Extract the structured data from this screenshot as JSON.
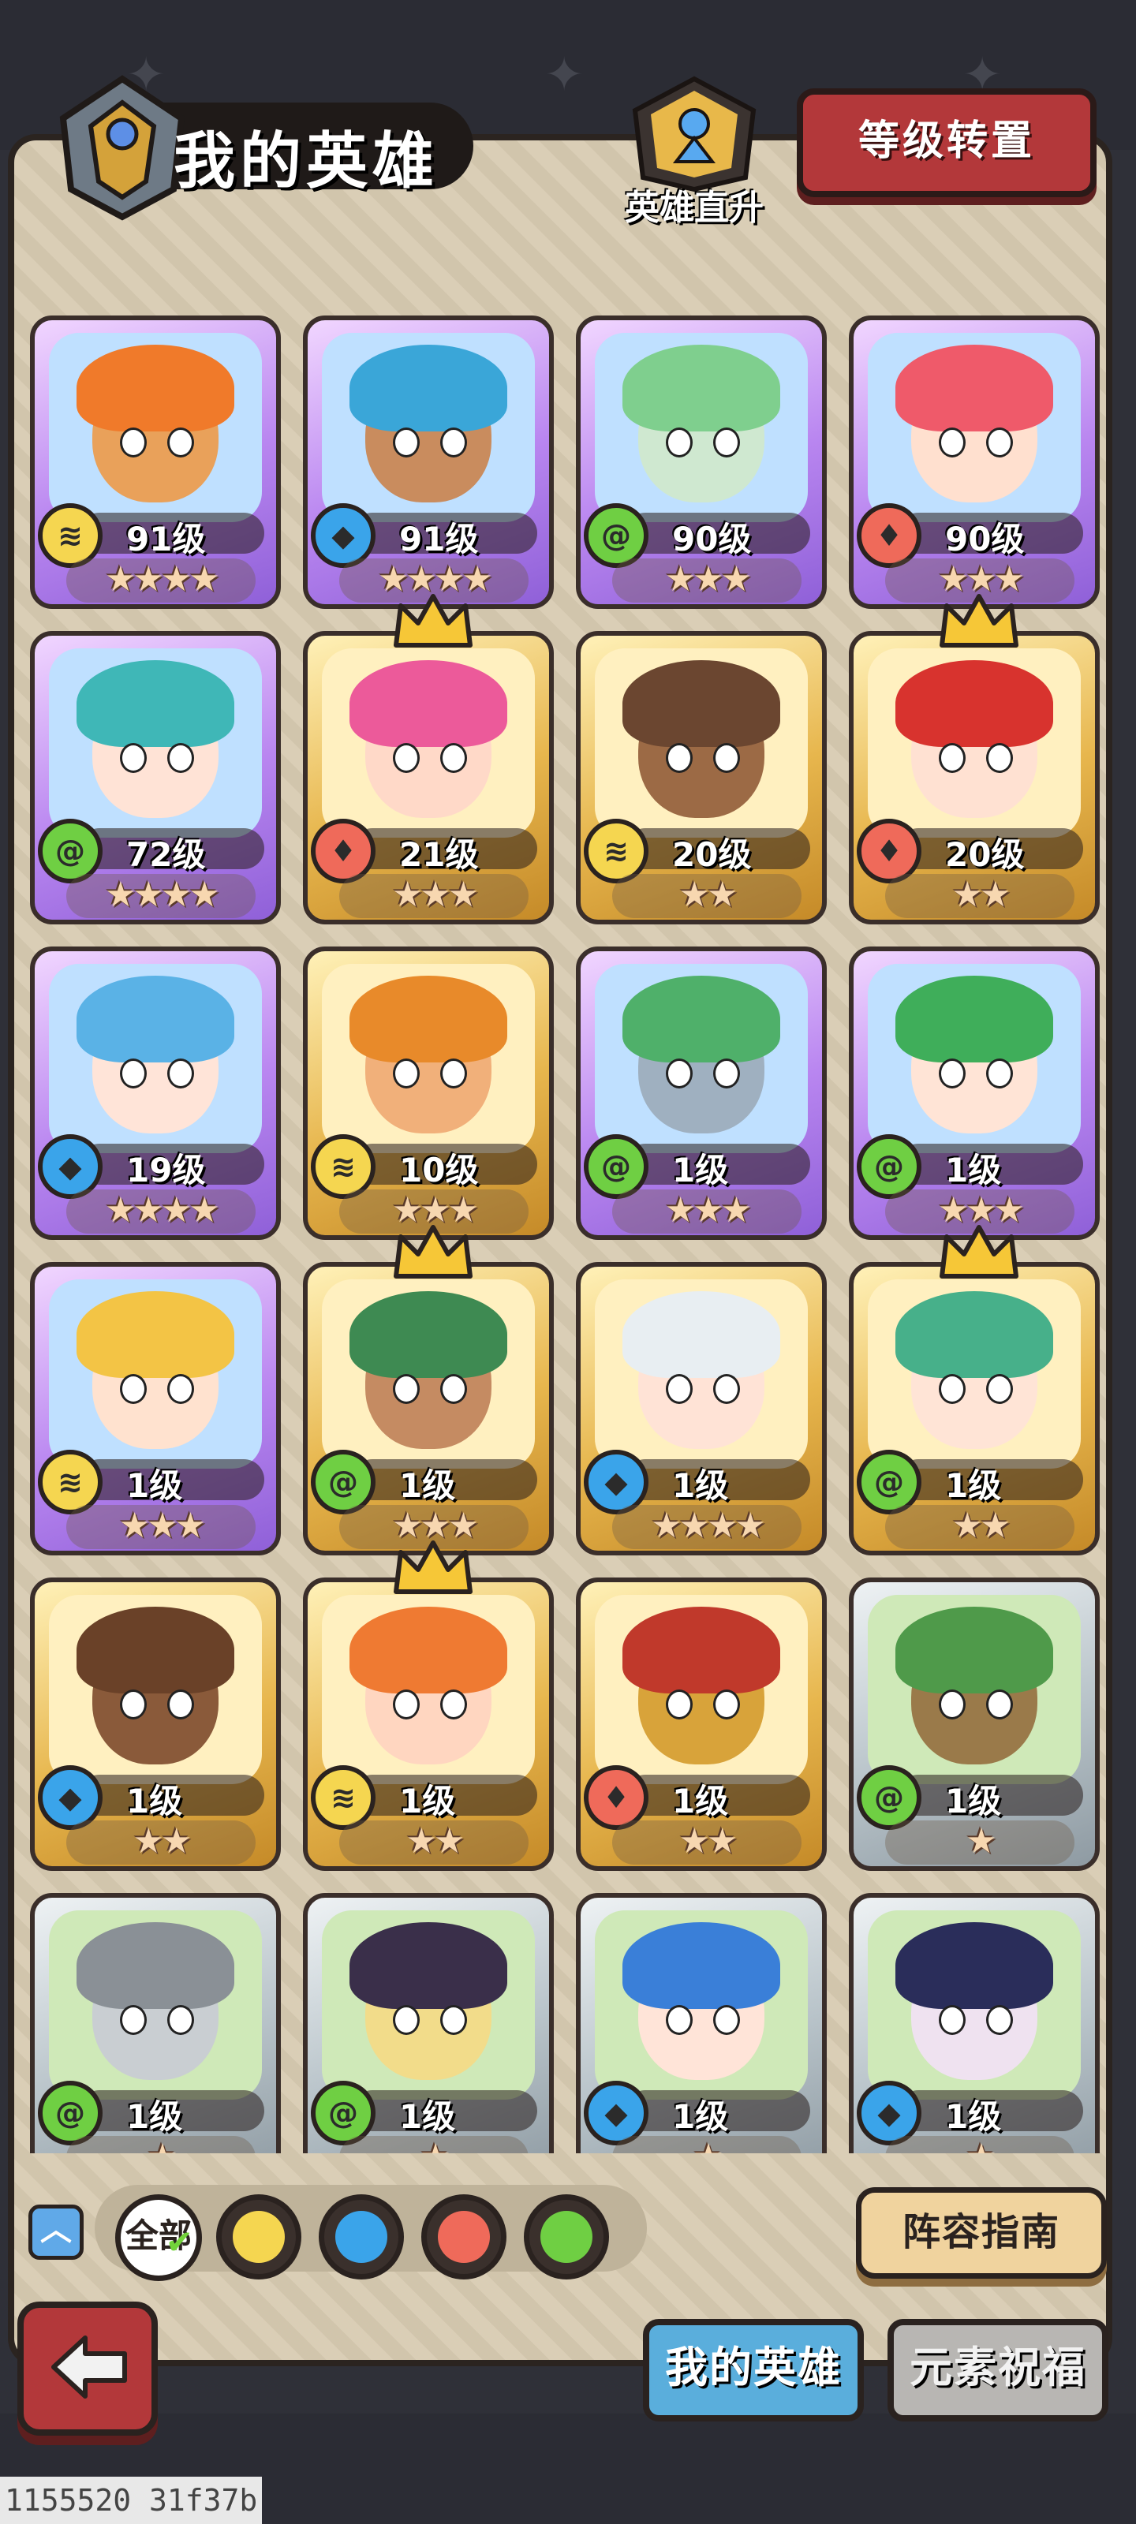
{
  "header": {
    "title": "我的英雄",
    "ascend_label": "英雄直升",
    "level_transfer_label": "等级转置"
  },
  "colors": {
    "earth": "#f5d650",
    "water": "#3aa4ea",
    "fire": "#ef6a5a",
    "wind": "#6fcf43",
    "rarity_purple": "#b986f0",
    "rarity_gold": "#e7b64d",
    "rarity_gray": "#b8c3c9"
  },
  "heroes": [
    {
      "level": "91级",
      "element": "earth",
      "stars": "★★★★",
      "rarity": "purple",
      "crown": false,
      "portrait": "tiger-warrior",
      "skin": "#e9a15a",
      "hair": "#f07a2a"
    },
    {
      "level": "91级",
      "element": "water",
      "stars": "★★★★",
      "rarity": "purple",
      "crown": false,
      "portrait": "blue-haired-rogue",
      "skin": "#c98c5e",
      "hair": "#3aa6d8"
    },
    {
      "level": "90级",
      "element": "wind",
      "stars": "★★★",
      "rarity": "purple",
      "crown": false,
      "portrait": "green-sorceress",
      "skin": "#cfe8d0",
      "hair": "#7fcf8e"
    },
    {
      "level": "90级",
      "element": "fire",
      "stars": "★★★",
      "rarity": "purple",
      "crown": false,
      "portrait": "rose-princess",
      "skin": "#ffe0cf",
      "hair": "#ef5a6a"
    },
    {
      "level": "72级",
      "element": "wind",
      "stars": "★★★★",
      "rarity": "purple",
      "crown": false,
      "portrait": "teal-elf-priestess",
      "skin": "#ffe3d6",
      "hair": "#3fb7b7"
    },
    {
      "level": "21级",
      "element": "fire",
      "stars": "★★★",
      "rarity": "gold",
      "crown": true,
      "portrait": "pink-pirate",
      "skin": "#ffd9c8",
      "hair": "#ec5a9a"
    },
    {
      "level": "20级",
      "element": "earth",
      "stars": "★★",
      "rarity": "gold",
      "crown": false,
      "portrait": "dreadlock-fighter",
      "skin": "#9c6a45",
      "hair": "#6b4630"
    },
    {
      "level": "20级",
      "element": "fire",
      "stars": "★★",
      "rarity": "gold",
      "crown": true,
      "portrait": "red-monocle-lady",
      "skin": "#ffe1d2",
      "hair": "#d8332e"
    },
    {
      "level": "19级",
      "element": "water",
      "stars": "★★★★",
      "rarity": "purple",
      "crown": false,
      "portrait": "blue-elf-girl",
      "skin": "#ffe4d8",
      "hair": "#5ab2e6"
    },
    {
      "level": "10级",
      "element": "earth",
      "stars": "★★★",
      "rarity": "gold",
      "crown": false,
      "portrait": "bearded-dwarf",
      "skin": "#f1b07a",
      "hair": "#e88a2a"
    },
    {
      "level": "1级",
      "element": "wind",
      "stars": "★★★",
      "rarity": "purple",
      "crown": false,
      "portrait": "old-sage",
      "skin": "#9fb0c0",
      "hair": "#4fb06a"
    },
    {
      "level": "1级",
      "element": "wind",
      "stars": "★★★",
      "rarity": "purple",
      "crown": false,
      "portrait": "green-elf-warrior",
      "skin": "#ffe4d6",
      "hair": "#3fae5a"
    },
    {
      "level": "1级",
      "element": "earth",
      "stars": "★★★",
      "rarity": "purple",
      "crown": false,
      "portrait": "blonde-girl",
      "skin": "#ffe2cf",
      "hair": "#f3c445"
    },
    {
      "level": "1级",
      "element": "wind",
      "stars": "★★★",
      "rarity": "gold",
      "crown": true,
      "portrait": "tattooed-chief",
      "skin": "#c58b62",
      "hair": "#3e8a52"
    },
    {
      "level": "1级",
      "element": "water",
      "stars": "★★★★",
      "rarity": "gold",
      "crown": false,
      "portrait": "silver-goggles-girl",
      "skin": "#ffe3d6",
      "hair": "#e8eef2"
    },
    {
      "level": "1级",
      "element": "wind",
      "stars": "★★",
      "rarity": "gold",
      "crown": true,
      "portrait": "jade-elf-queen",
      "skin": "#ffe4d6",
      "hair": "#47b08a"
    },
    {
      "level": "1级",
      "element": "water",
      "stars": "★★",
      "rarity": "gold",
      "crown": false,
      "portrait": "wooden-golem",
      "skin": "#8a5a3a",
      "hair": "#6a4128"
    },
    {
      "level": "1级",
      "element": "earth",
      "stars": "★★",
      "rarity": "gold",
      "crown": true,
      "portrait": "orange-huntress",
      "skin": "#ffd6c0",
      "hair": "#ef7a32"
    },
    {
      "level": "1级",
      "element": "fire",
      "stars": "★★",
      "rarity": "gold",
      "crown": false,
      "portrait": "spartan-helmet",
      "skin": "#d8a33a",
      "hair": "#c0392b"
    },
    {
      "level": "1级",
      "element": "wind",
      "stars": "★",
      "rarity": "gray",
      "crown": false,
      "portrait": "tree-sprout",
      "skin": "#9a7a4a",
      "hair": "#4f9a4a"
    },
    {
      "level": "1级",
      "element": "wind",
      "stars": "★",
      "rarity": "gray",
      "crown": false,
      "portrait": "knight-helmet",
      "skin": "#c9ced2",
      "hair": "#8a9096"
    },
    {
      "level": "1级",
      "element": "wind",
      "stars": "★",
      "rarity": "gray",
      "crown": false,
      "portrait": "horned-shaman",
      "skin": "#f2dc8a",
      "hair": "#3a2f4a"
    },
    {
      "level": "1级",
      "element": "water",
      "stars": "★",
      "rarity": "gray",
      "crown": false,
      "portrait": "blue-bob-girl",
      "skin": "#ffe4d8",
      "hair": "#3a7fd8"
    },
    {
      "level": "1级",
      "element": "water",
      "stars": "★",
      "rarity": "gray",
      "crown": false,
      "portrait": "dark-witch",
      "skin": "#efe2f0",
      "hair": "#2a2d5a"
    }
  ],
  "filters": {
    "all_label": "全部",
    "elements": [
      "earth",
      "water",
      "fire",
      "wind"
    ]
  },
  "guide_label": "阵容指南",
  "tabs": {
    "my_heroes": "我的英雄",
    "element_blessing": "元素祝福"
  },
  "debug_text": "1155520 31f37b"
}
